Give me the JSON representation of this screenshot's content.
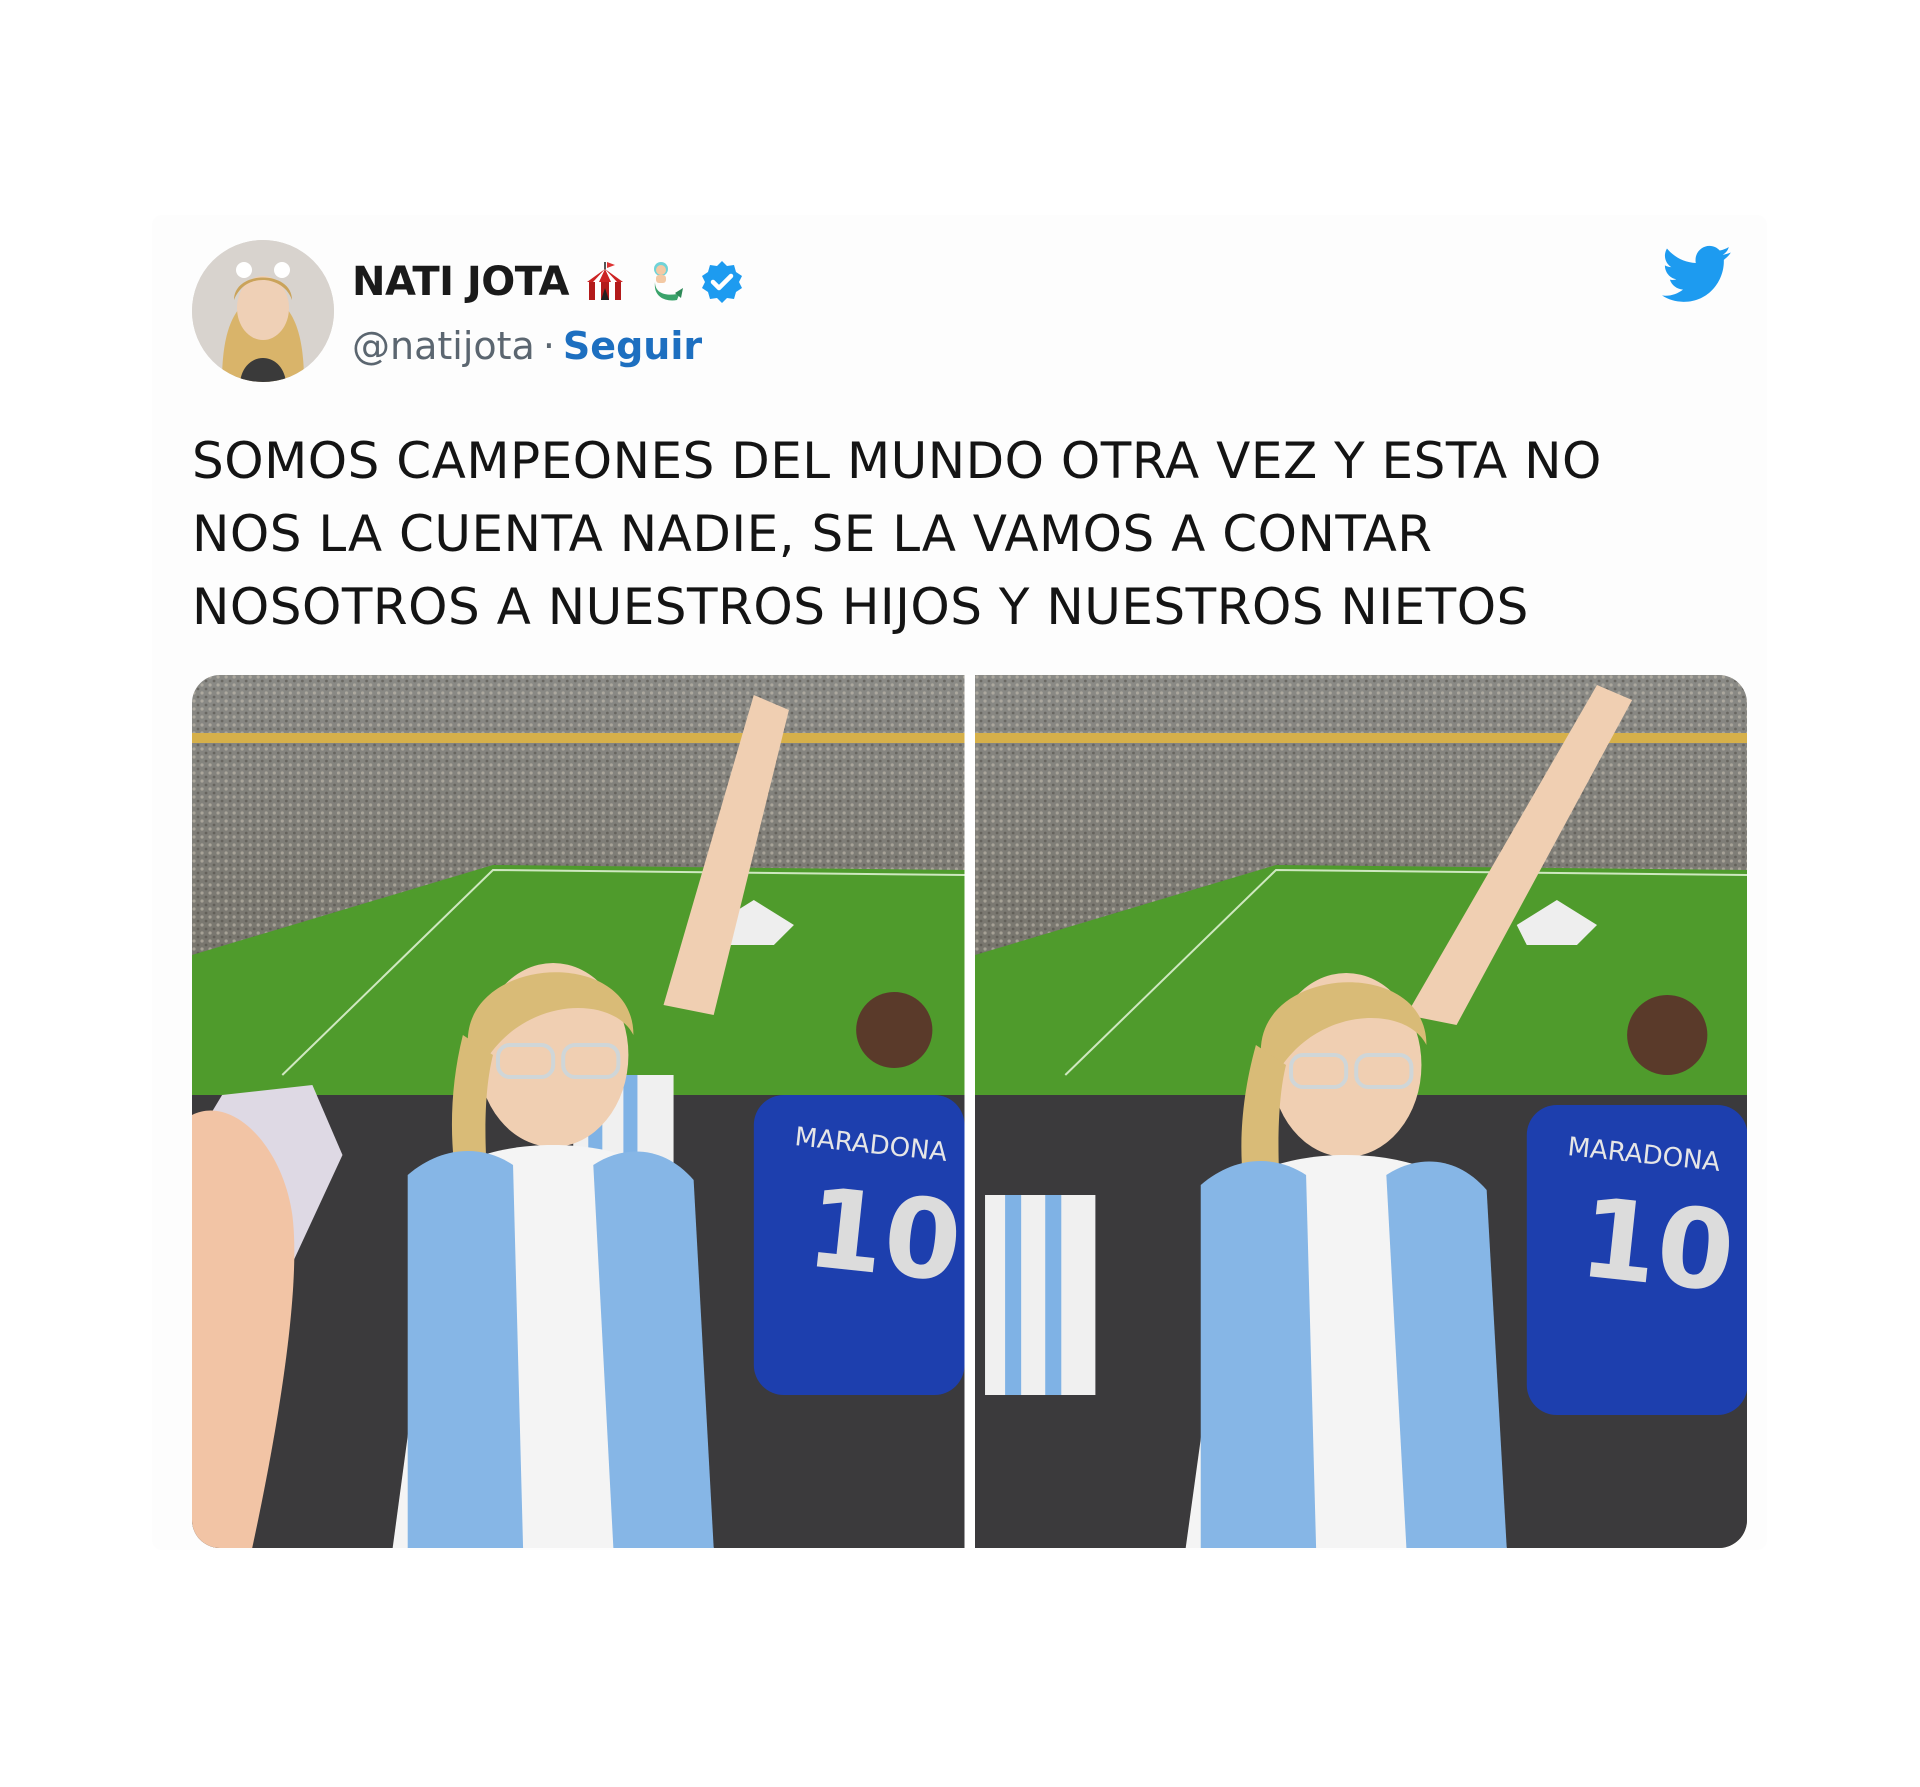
{
  "tweet": {
    "display_name": "NATI JOTA",
    "name_emojis": [
      "circus-tent",
      "mermaid"
    ],
    "verified": true,
    "handle": "@natijota",
    "separator": "·",
    "follow_label": "Seguir",
    "text": "SOMOS CAMPEONES DEL MUNDO OTRA VEZ Y ESTA NO\nNOS LA CUENTA NADIE, SE LA VAMOS A CONTAR\nNOSOTROS A NUESTROS HIJOS Y NUESTROS NIETOS",
    "photos": [
      {
        "jersey_name": "MARADONA",
        "jersey_number": "10"
      },
      {
        "jersey_name": "MARADONA",
        "jersey_number": "10"
      }
    ]
  },
  "colors": {
    "link_blue": "#1d6fc0",
    "twitter_blue": "#1d9bf0",
    "verified_blue": "#1d9bf0",
    "argentina_sky": "#7fb2e5",
    "pitch_green": "#4f9b2c"
  },
  "icons": [
    "twitter-bird-icon",
    "verified-badge-icon"
  ]
}
